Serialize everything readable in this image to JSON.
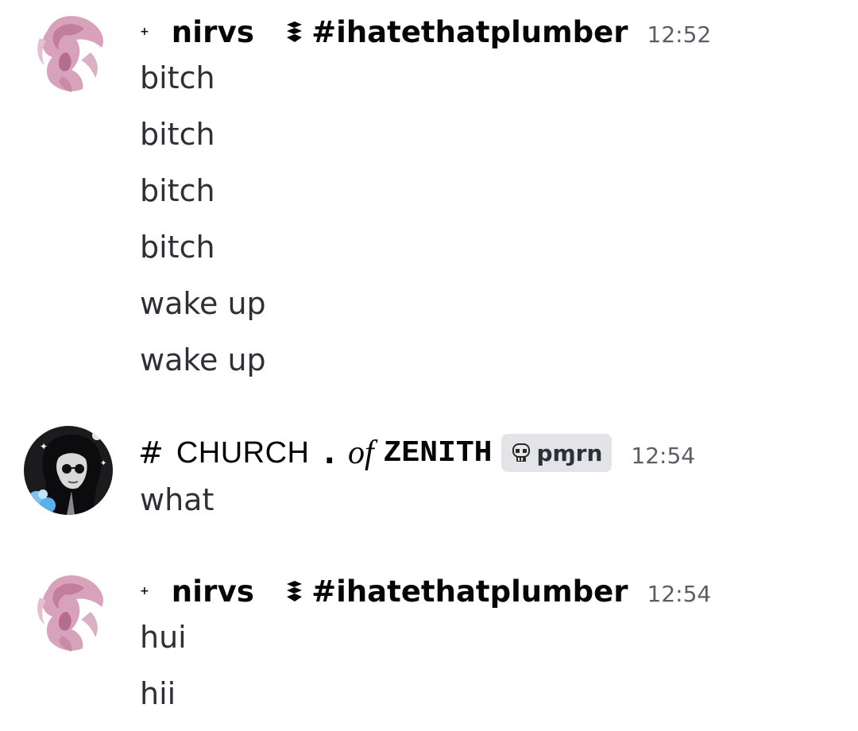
{
  "messages": [
    {
      "author": "nirvs",
      "sparkle_glyph": "+",
      "tag_icon": "wave-guild-icon",
      "tag": "#ihatethatplumber",
      "timestamp": "12:52",
      "avatar": "pink-figure-avatar",
      "lines": [
        "bitch",
        "bitch",
        "bitch",
        "bitch",
        "wake up",
        "wake up"
      ]
    },
    {
      "author_parts": {
        "hash": "#",
        "word": "CHURCH",
        "dot": ".",
        "of": "of",
        "zenith": "ZENITH"
      },
      "role_badge": {
        "icon": "skull-icon",
        "label": "pɱrn"
      },
      "timestamp": "12:54",
      "avatar": "dark-goth-avatar",
      "lines": [
        "what"
      ]
    },
    {
      "author": "nirvs",
      "sparkle_glyph": "+",
      "tag_icon": "wave-guild-icon",
      "tag": "#ihatethatplumber",
      "timestamp": "12:54",
      "avatar": "pink-figure-avatar",
      "lines": [
        "hui",
        "hii"
      ]
    }
  ],
  "colors": {
    "text": "#2e3035",
    "username": "#060607",
    "timestamp": "#5c5e66",
    "badge_bg": "#e3e4e8",
    "avatar_pink": "#c98aa7"
  }
}
